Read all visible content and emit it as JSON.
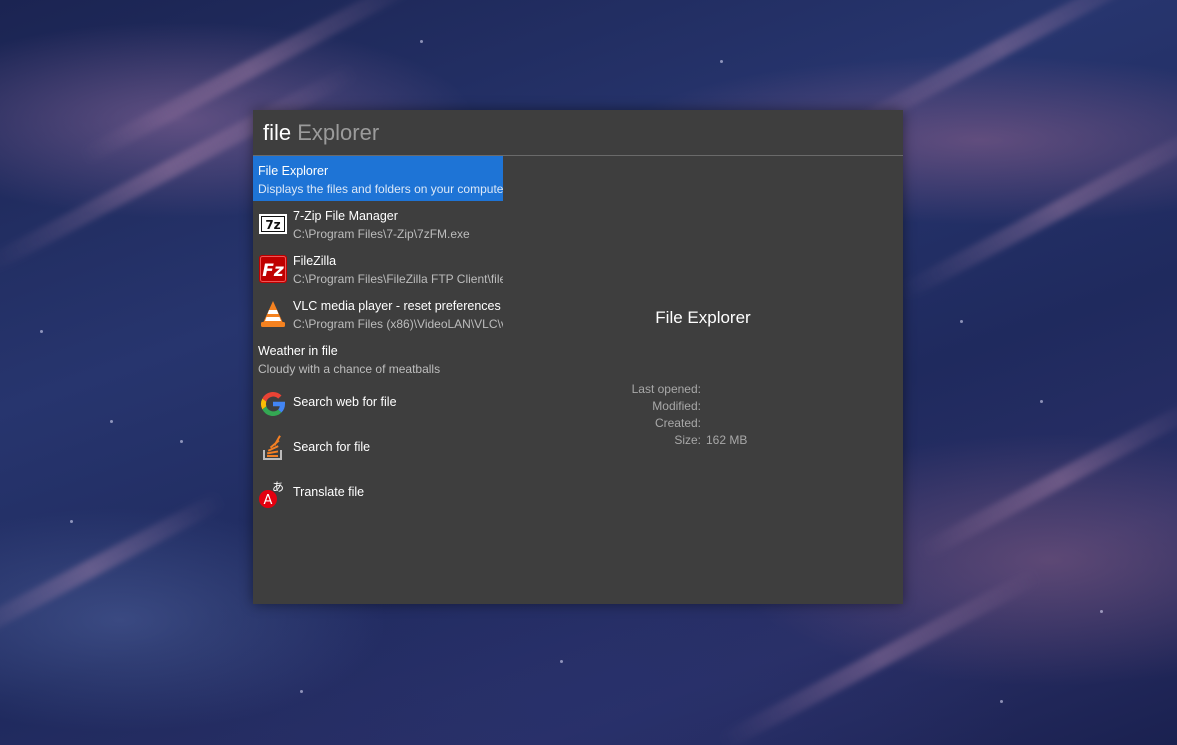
{
  "search": {
    "typed": "file",
    "suggestion": " Explorer"
  },
  "results": [
    {
      "title": "File Explorer",
      "subtitle": "Displays the files and folders on your compute",
      "icon": "none",
      "selected": true
    },
    {
      "title": "7-Zip File Manager",
      "subtitle": "C:\\Program Files\\7-Zip\\7zFM.exe",
      "icon": "7zip-icon"
    },
    {
      "title": "FileZilla",
      "subtitle": "C:\\Program Files\\FileZilla FTP Client\\filez",
      "icon": "filezilla-icon"
    },
    {
      "title": "VLC media player - reset preferences",
      "subtitle": "C:\\Program Files (x86)\\VideoLAN\\VLC\\v",
      "icon": "vlc-icon"
    },
    {
      "title": "Weather in file",
      "subtitle": "Cloudy with a chance of meatballs",
      "icon": "none"
    },
    {
      "title": "Search web for file",
      "icon": "google-icon"
    },
    {
      "title": "Search for file",
      "icon": "stackoverflow-icon"
    },
    {
      "title": "Translate file",
      "icon": "translate-icon"
    }
  ],
  "preview": {
    "title": "File Explorer",
    "last_opened_label": "Last opened:",
    "last_opened_value": "",
    "modified_label": "Modified:",
    "modified_value": "",
    "created_label": "Created:",
    "created_value": "",
    "size_label": "Size:",
    "size_value": "162 MB"
  },
  "colors": {
    "selection": "#1e74d6",
    "panel": "#3e3e3e"
  }
}
